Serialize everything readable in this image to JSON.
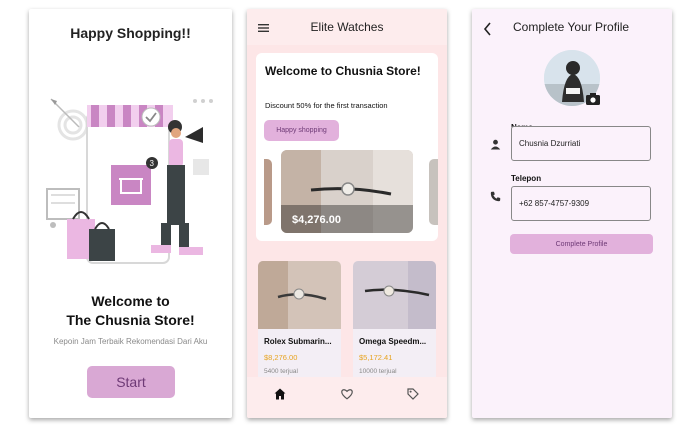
{
  "onboarding": {
    "title": "Happy Shopping!!",
    "welcome_line1": "Welcome to",
    "welcome_line2": "The Chusnia Store!",
    "subtitle": "Kepoin Jam Terbaik Rekomendasi Dari Aku",
    "start_label": "Start",
    "badge_count": "3",
    "colors": {
      "accent": "#d9a8d4",
      "accent_text": "#6e3a76"
    }
  },
  "home": {
    "app_title": "Elite Watches",
    "promo": {
      "title": "Welcome to Chusnia Store!",
      "subtitle": "Discount 50% for the first transaction",
      "chip_label": "Happy shopping",
      "hero_price": "$4,276.00"
    },
    "products": [
      {
        "name": "Rolex Submarin...",
        "price": "$8,276.00",
        "sold": "5400 terjual"
      },
      {
        "name": "Omega Speedm...",
        "price": "$5,172.41",
        "sold": "10000 terjual"
      }
    ],
    "nav": [
      {
        "icon": "home-icon",
        "active": true
      },
      {
        "icon": "heart-icon",
        "active": false
      },
      {
        "icon": "tag-icon",
        "active": false
      }
    ],
    "colors": {
      "background": "#fde6e7",
      "price": "#e7a421"
    }
  },
  "profile": {
    "title": "Complete Your Profile",
    "name_label": "Nama",
    "name_value": "Chusnia Dzurriati",
    "phone_label": "Telepon",
    "phone_value": "+62 857-4757-9309",
    "submit_label": "Complete Profile"
  }
}
